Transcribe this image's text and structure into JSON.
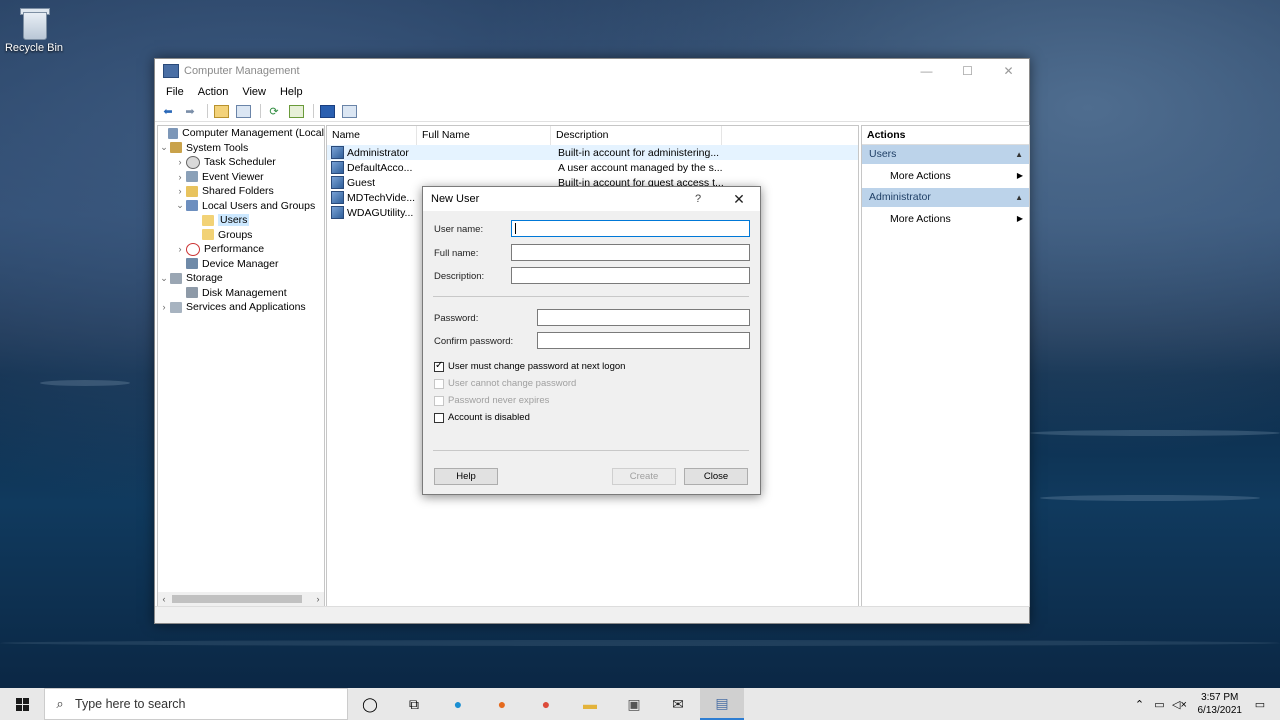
{
  "desktop": {
    "recycle_bin_label": "Recycle Bin"
  },
  "window": {
    "title": "Computer Management",
    "controls": {
      "minimize": "—",
      "maximize": "☐",
      "close": "✕"
    },
    "menu": [
      "File",
      "Action",
      "View",
      "Help"
    ]
  },
  "tree": {
    "items": [
      {
        "label": "Computer Management (Local",
        "exp": "",
        "icon": "computer-icon"
      },
      {
        "label": "System Tools",
        "exp": "⌄",
        "icon": "tools-icon"
      },
      {
        "label": "Task Scheduler",
        "exp": "›",
        "icon": "clock-icon"
      },
      {
        "label": "Event Viewer",
        "exp": "›",
        "icon": "event-icon"
      },
      {
        "label": "Shared Folders",
        "exp": "›",
        "icon": "shared-folder-icon"
      },
      {
        "label": "Local Users and Groups",
        "exp": "⌄",
        "icon": "users-icon"
      },
      {
        "label": "Users",
        "exp": "",
        "icon": "folder-icon"
      },
      {
        "label": "Groups",
        "exp": "",
        "icon": "folder-icon"
      },
      {
        "label": "Performance",
        "exp": "›",
        "icon": "performance-icon"
      },
      {
        "label": "Device Manager",
        "exp": "",
        "icon": "device-icon"
      },
      {
        "label": "Storage",
        "exp": "⌄",
        "icon": "storage-icon"
      },
      {
        "label": "Disk Management",
        "exp": "",
        "icon": "disk-icon"
      },
      {
        "label": "Services and Applications",
        "exp": "›",
        "icon": "services-icon"
      }
    ]
  },
  "list": {
    "columns": [
      "Name",
      "Full Name",
      "Description"
    ],
    "rows": [
      {
        "name": "Administrator",
        "full": "",
        "desc": "Built-in account for administering..."
      },
      {
        "name": "DefaultAcco...",
        "full": "",
        "desc": "A user account managed by the s..."
      },
      {
        "name": "Guest",
        "full": "",
        "desc": "Built-in account for guest access t..."
      },
      {
        "name": "MDTechVide...",
        "full": "",
        "desc": ""
      },
      {
        "name": "WDAGUtility...",
        "full": "",
        "desc": ""
      }
    ]
  },
  "actions": {
    "title": "Actions",
    "section1": "Users",
    "section2": "Administrator",
    "more": "More Actions"
  },
  "dialog": {
    "title": "New User",
    "help_glyph": "?",
    "close_glyph": "✕",
    "labels": {
      "username": "User name:",
      "fullname": "Full name:",
      "description": "Description:",
      "password": "Password:",
      "confirm": "Confirm password:"
    },
    "values": {
      "username": "",
      "fullname": "",
      "description": "",
      "password": "",
      "confirm": ""
    },
    "checkboxes": {
      "must_change": "User must change password at next logon",
      "cannot_change": "User cannot change password",
      "never_expires": "Password never expires",
      "disabled": "Account is disabled"
    },
    "buttons": {
      "help": "Help",
      "create": "Create",
      "close": "Close"
    }
  },
  "taskbar": {
    "search_placeholder": "Type here to search",
    "time": "3:57 PM",
    "date": "6/13/2021"
  }
}
